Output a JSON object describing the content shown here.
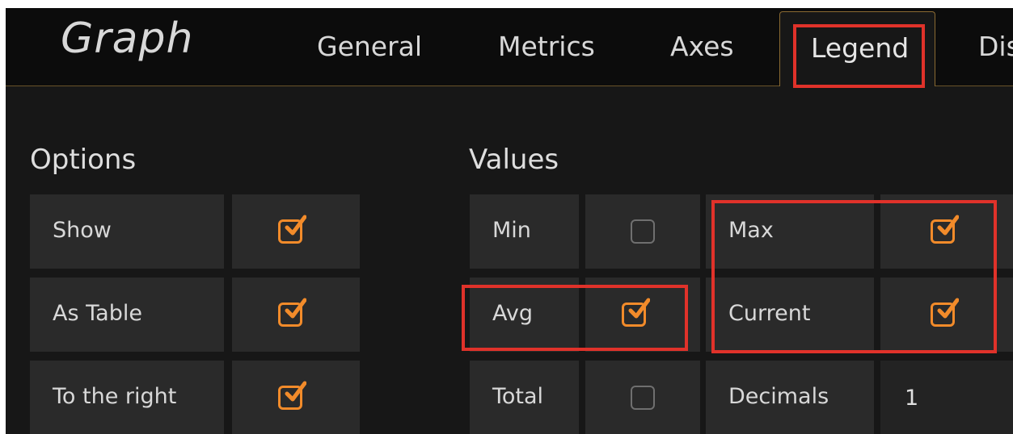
{
  "header": {
    "title": "Graph",
    "tabs": [
      {
        "label": "General"
      },
      {
        "label": "Metrics"
      },
      {
        "label": "Axes"
      },
      {
        "label": "Legend"
      },
      {
        "label": "Dis"
      }
    ],
    "active_tab": "Legend"
  },
  "options": {
    "title": "Options",
    "rows": [
      {
        "label": "Show",
        "checked": true
      },
      {
        "label": "As Table",
        "checked": true
      },
      {
        "label": "To the right",
        "checked": true
      }
    ]
  },
  "values": {
    "title": "Values",
    "rows": [
      {
        "label": "Min",
        "checked": false
      },
      {
        "label": "Avg",
        "checked": true
      },
      {
        "label": "Total",
        "checked": false
      },
      {
        "label": "Max",
        "checked": true
      },
      {
        "label": "Current",
        "checked": true
      }
    ],
    "decimals": {
      "label": "Decimals",
      "value": "1"
    }
  },
  "colors": {
    "accent": "#f28b2a",
    "highlight": "#e0322a"
  }
}
